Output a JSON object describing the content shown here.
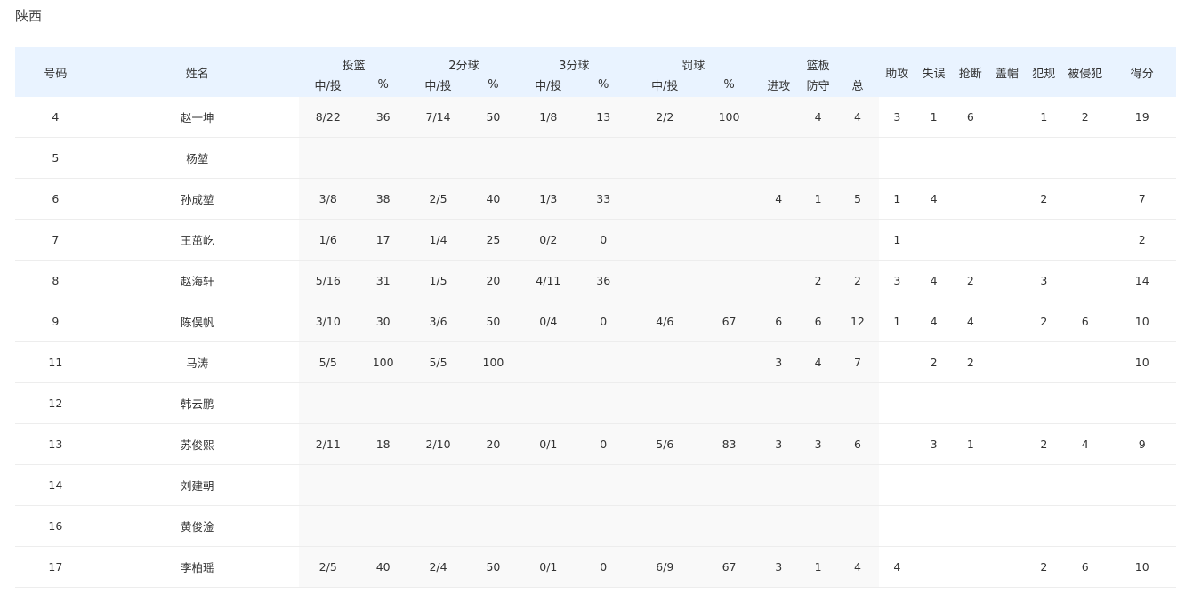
{
  "team": "陕西",
  "headers": {
    "number": "号码",
    "name": "姓名",
    "fg": "投篮",
    "two": "2分球",
    "three": "3分球",
    "ft": "罚球",
    "reb": "篮板",
    "made_att": "中/投",
    "pct": "%",
    "off": "进攻",
    "def": "防守",
    "tot": "总",
    "ast": "助攻",
    "tov": "失误",
    "stl": "抢断",
    "blk": "盖帽",
    "pf": "犯规",
    "fd": "被侵犯",
    "pts": "得分"
  },
  "players": [
    {
      "num": "4",
      "name": "赵一坤",
      "fg": "8/22",
      "fg_pct": "36",
      "p2": "7/14",
      "p2_pct": "50",
      "p3": "1/8",
      "p3_pct": "13",
      "ft": "2/2",
      "ft_pct": "100",
      "oreb": "",
      "dreb": "4",
      "reb": "4",
      "ast": "3",
      "tov": "1",
      "stl": "6",
      "blk": "",
      "pf": "1",
      "fd": "2",
      "pts": "19"
    },
    {
      "num": "5",
      "name": "杨堃",
      "fg": "",
      "fg_pct": "",
      "p2": "",
      "p2_pct": "",
      "p3": "",
      "p3_pct": "",
      "ft": "",
      "ft_pct": "",
      "oreb": "",
      "dreb": "",
      "reb": "",
      "ast": "",
      "tov": "",
      "stl": "",
      "blk": "",
      "pf": "",
      "fd": "",
      "pts": ""
    },
    {
      "num": "6",
      "name": "孙成堃",
      "fg": "3/8",
      "fg_pct": "38",
      "p2": "2/5",
      "p2_pct": "40",
      "p3": "1/3",
      "p3_pct": "33",
      "ft": "",
      "ft_pct": "",
      "oreb": "4",
      "dreb": "1",
      "reb": "5",
      "ast": "1",
      "tov": "4",
      "stl": "",
      "blk": "",
      "pf": "2",
      "fd": "",
      "pts": "7"
    },
    {
      "num": "7",
      "name": "王茁屹",
      "fg": "1/6",
      "fg_pct": "17",
      "p2": "1/4",
      "p2_pct": "25",
      "p3": "0/2",
      "p3_pct": "0",
      "ft": "",
      "ft_pct": "",
      "oreb": "",
      "dreb": "",
      "reb": "",
      "ast": "1",
      "tov": "",
      "stl": "",
      "blk": "",
      "pf": "",
      "fd": "",
      "pts": "2"
    },
    {
      "num": "8",
      "name": "赵海轩",
      "fg": "5/16",
      "fg_pct": "31",
      "p2": "1/5",
      "p2_pct": "20",
      "p3": "4/11",
      "p3_pct": "36",
      "ft": "",
      "ft_pct": "",
      "oreb": "",
      "dreb": "2",
      "reb": "2",
      "ast": "3",
      "tov": "4",
      "stl": "2",
      "blk": "",
      "pf": "3",
      "fd": "",
      "pts": "14"
    },
    {
      "num": "9",
      "name": "陈俣帆",
      "fg": "3/10",
      "fg_pct": "30",
      "p2": "3/6",
      "p2_pct": "50",
      "p3": "0/4",
      "p3_pct": "0",
      "ft": "4/6",
      "ft_pct": "67",
      "oreb": "6",
      "dreb": "6",
      "reb": "12",
      "ast": "1",
      "tov": "4",
      "stl": "4",
      "blk": "",
      "pf": "2",
      "fd": "6",
      "pts": "10"
    },
    {
      "num": "11",
      "name": "马涛",
      "fg": "5/5",
      "fg_pct": "100",
      "p2": "5/5",
      "p2_pct": "100",
      "p3": "",
      "p3_pct": "",
      "ft": "",
      "ft_pct": "",
      "oreb": "3",
      "dreb": "4",
      "reb": "7",
      "ast": "",
      "tov": "2",
      "stl": "2",
      "blk": "",
      "pf": "",
      "fd": "",
      "pts": "10"
    },
    {
      "num": "12",
      "name": "韩云鹏",
      "fg": "",
      "fg_pct": "",
      "p2": "",
      "p2_pct": "",
      "p3": "",
      "p3_pct": "",
      "ft": "",
      "ft_pct": "",
      "oreb": "",
      "dreb": "",
      "reb": "",
      "ast": "",
      "tov": "",
      "stl": "",
      "blk": "",
      "pf": "",
      "fd": "",
      "pts": ""
    },
    {
      "num": "13",
      "name": "苏俊熙",
      "fg": "2/11",
      "fg_pct": "18",
      "p2": "2/10",
      "p2_pct": "20",
      "p3": "0/1",
      "p3_pct": "0",
      "ft": "5/6",
      "ft_pct": "83",
      "oreb": "3",
      "dreb": "3",
      "reb": "6",
      "ast": "",
      "tov": "3",
      "stl": "1",
      "blk": "",
      "pf": "2",
      "fd": "4",
      "pts": "9"
    },
    {
      "num": "14",
      "name": "刘建朝",
      "fg": "",
      "fg_pct": "",
      "p2": "",
      "p2_pct": "",
      "p3": "",
      "p3_pct": "",
      "ft": "",
      "ft_pct": "",
      "oreb": "",
      "dreb": "",
      "reb": "",
      "ast": "",
      "tov": "",
      "stl": "",
      "blk": "",
      "pf": "",
      "fd": "",
      "pts": ""
    },
    {
      "num": "16",
      "name": "黄俊淦",
      "fg": "",
      "fg_pct": "",
      "p2": "",
      "p2_pct": "",
      "p3": "",
      "p3_pct": "",
      "ft": "",
      "ft_pct": "",
      "oreb": "",
      "dreb": "",
      "reb": "",
      "ast": "",
      "tov": "",
      "stl": "",
      "blk": "",
      "pf": "",
      "fd": "",
      "pts": ""
    },
    {
      "num": "17",
      "name": "李柏瑶",
      "fg": "2/5",
      "fg_pct": "40",
      "p2": "2/4",
      "p2_pct": "50",
      "p3": "0/1",
      "p3_pct": "0",
      "ft": "6/9",
      "ft_pct": "67",
      "oreb": "3",
      "dreb": "1",
      "reb": "4",
      "ast": "4",
      "tov": "",
      "stl": "",
      "blk": "",
      "pf": "2",
      "fd": "6",
      "pts": "10"
    }
  ]
}
